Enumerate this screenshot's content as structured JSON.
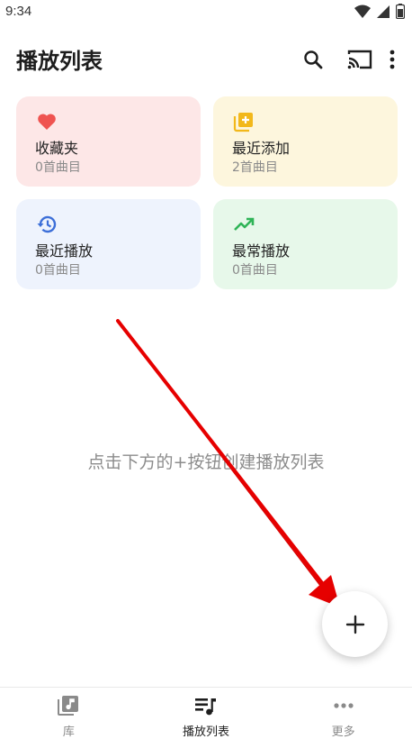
{
  "status_bar": {
    "time": "9:34"
  },
  "app_bar": {
    "title": "播放列表"
  },
  "cards": [
    {
      "title": "收藏夹",
      "subtitle": "0首曲目",
      "icon": "heart-icon",
      "bg": "#fde7e7",
      "accent": "#ef5350"
    },
    {
      "title": "最近添加",
      "subtitle": "2首曲目",
      "icon": "library-add-icon",
      "bg": "#fdf6dd",
      "accent": "#f2b81b"
    },
    {
      "title": "最近播放",
      "subtitle": "0首曲目",
      "icon": "history-icon",
      "bg": "#eef3fd",
      "accent": "#3d6fd8"
    },
    {
      "title": "最常播放",
      "subtitle": "0首曲目",
      "icon": "trending-up-icon",
      "bg": "#e7f8ea",
      "accent": "#2fb457"
    }
  ],
  "empty_hint": "点击下方的+按钮创建播放列表",
  "bottom_nav": [
    {
      "label": "库",
      "icon": "music-library-icon",
      "active": false
    },
    {
      "label": "播放列表",
      "icon": "playlist-icon",
      "active": true
    },
    {
      "label": "更多",
      "icon": "more-horizontal-icon",
      "active": false
    }
  ]
}
